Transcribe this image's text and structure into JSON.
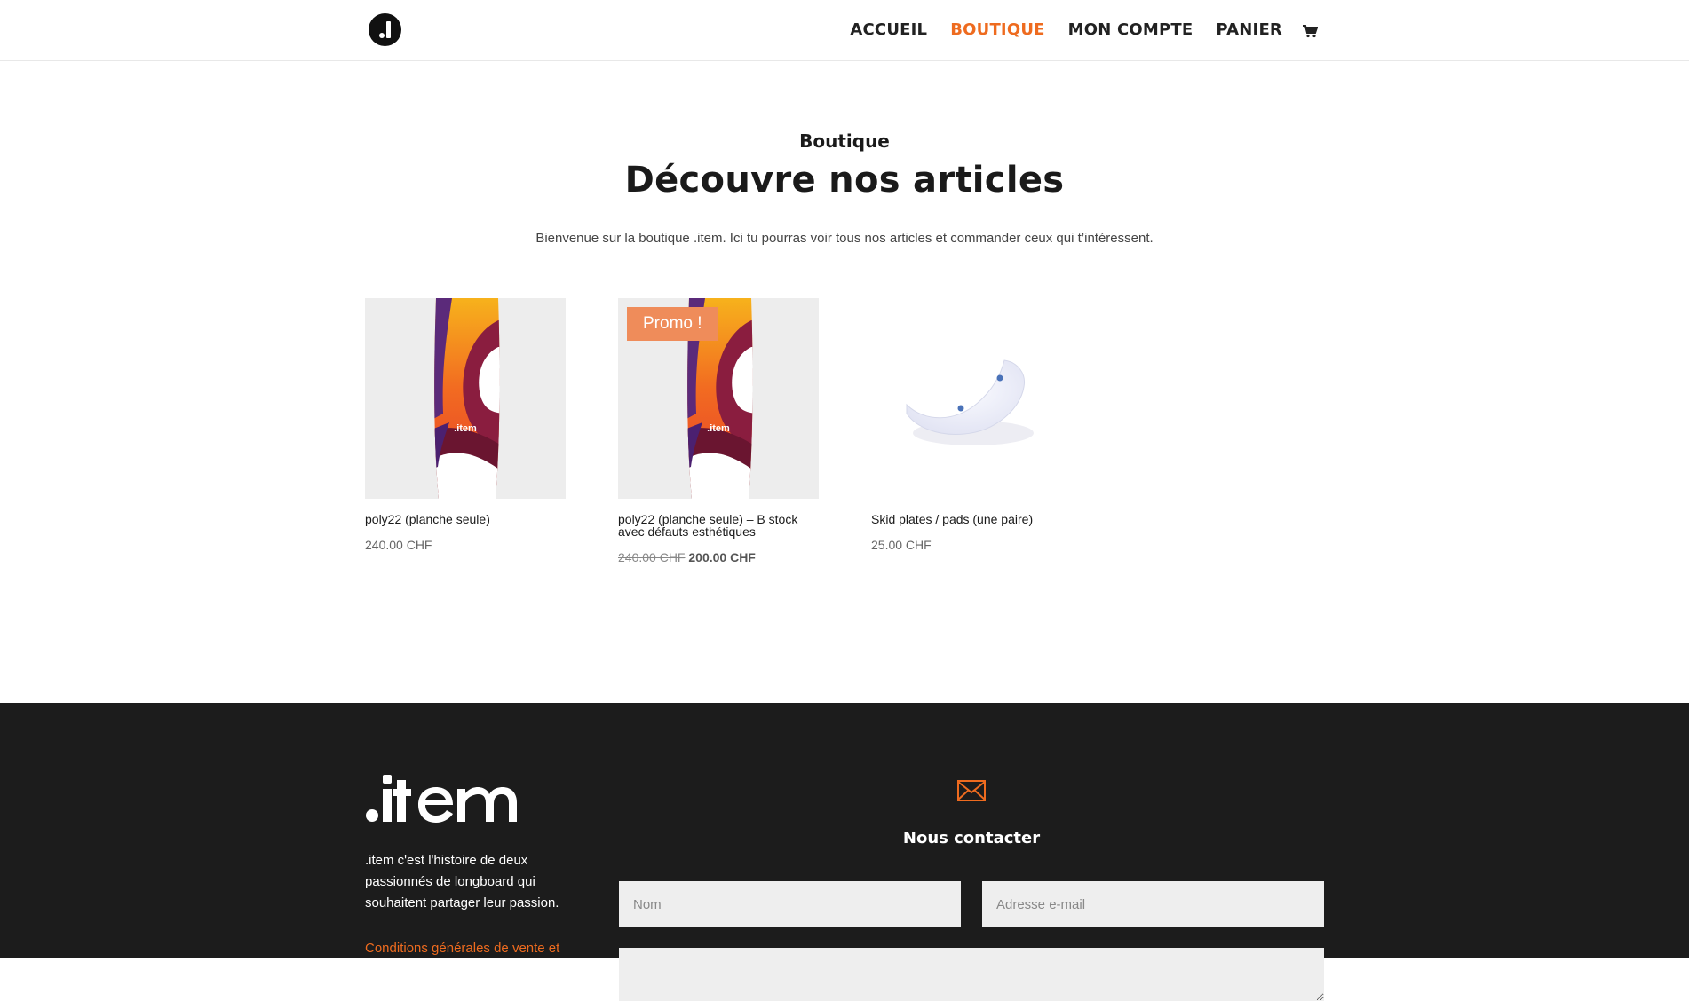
{
  "header": {
    "logo_name": "dot-item-logo",
    "nav": [
      {
        "label": "ACCUEIL",
        "active": false
      },
      {
        "label": "BOUTIQUE",
        "active": true
      },
      {
        "label": "MON COMPTE",
        "active": false
      },
      {
        "label": "PANIER",
        "active": false
      }
    ],
    "cart_icon": "cart-icon",
    "accent_color": "#ee6b1f"
  },
  "intro": {
    "subtitle": "Boutique",
    "title": "Découvre nos articles",
    "text": "Bienvenue sur la boutique .item. Ici tu pourras voir tous nos articles et commander ceux qui t’intéressent."
  },
  "products": [
    {
      "name": "poly22 (planche seule)",
      "price": "240.00 CHF",
      "badge": "",
      "board_text": ".item"
    },
    {
      "name": "poly22 (planche seule) – B stock avec défauts esthétiques",
      "old_price": "240.00 CHF",
      "price": "200.00 CHF",
      "badge": "Promo !",
      "board_text": ".item"
    },
    {
      "name": "Skid plates / pads (une paire)",
      "price": "25.00 CHF",
      "badge": ""
    }
  ],
  "footer": {
    "description": ".item c'est l'histoire de deux passionnés de longboard qui souhaitent partager leur passion.",
    "link": "Conditions générales de vente et",
    "contact_icon": "envelope-icon",
    "contact_title": "Nous contacter",
    "fields": {
      "name_placeholder": "Nom",
      "email_placeholder": "Adresse e-mail"
    },
    "background": "#1c1c1c"
  }
}
